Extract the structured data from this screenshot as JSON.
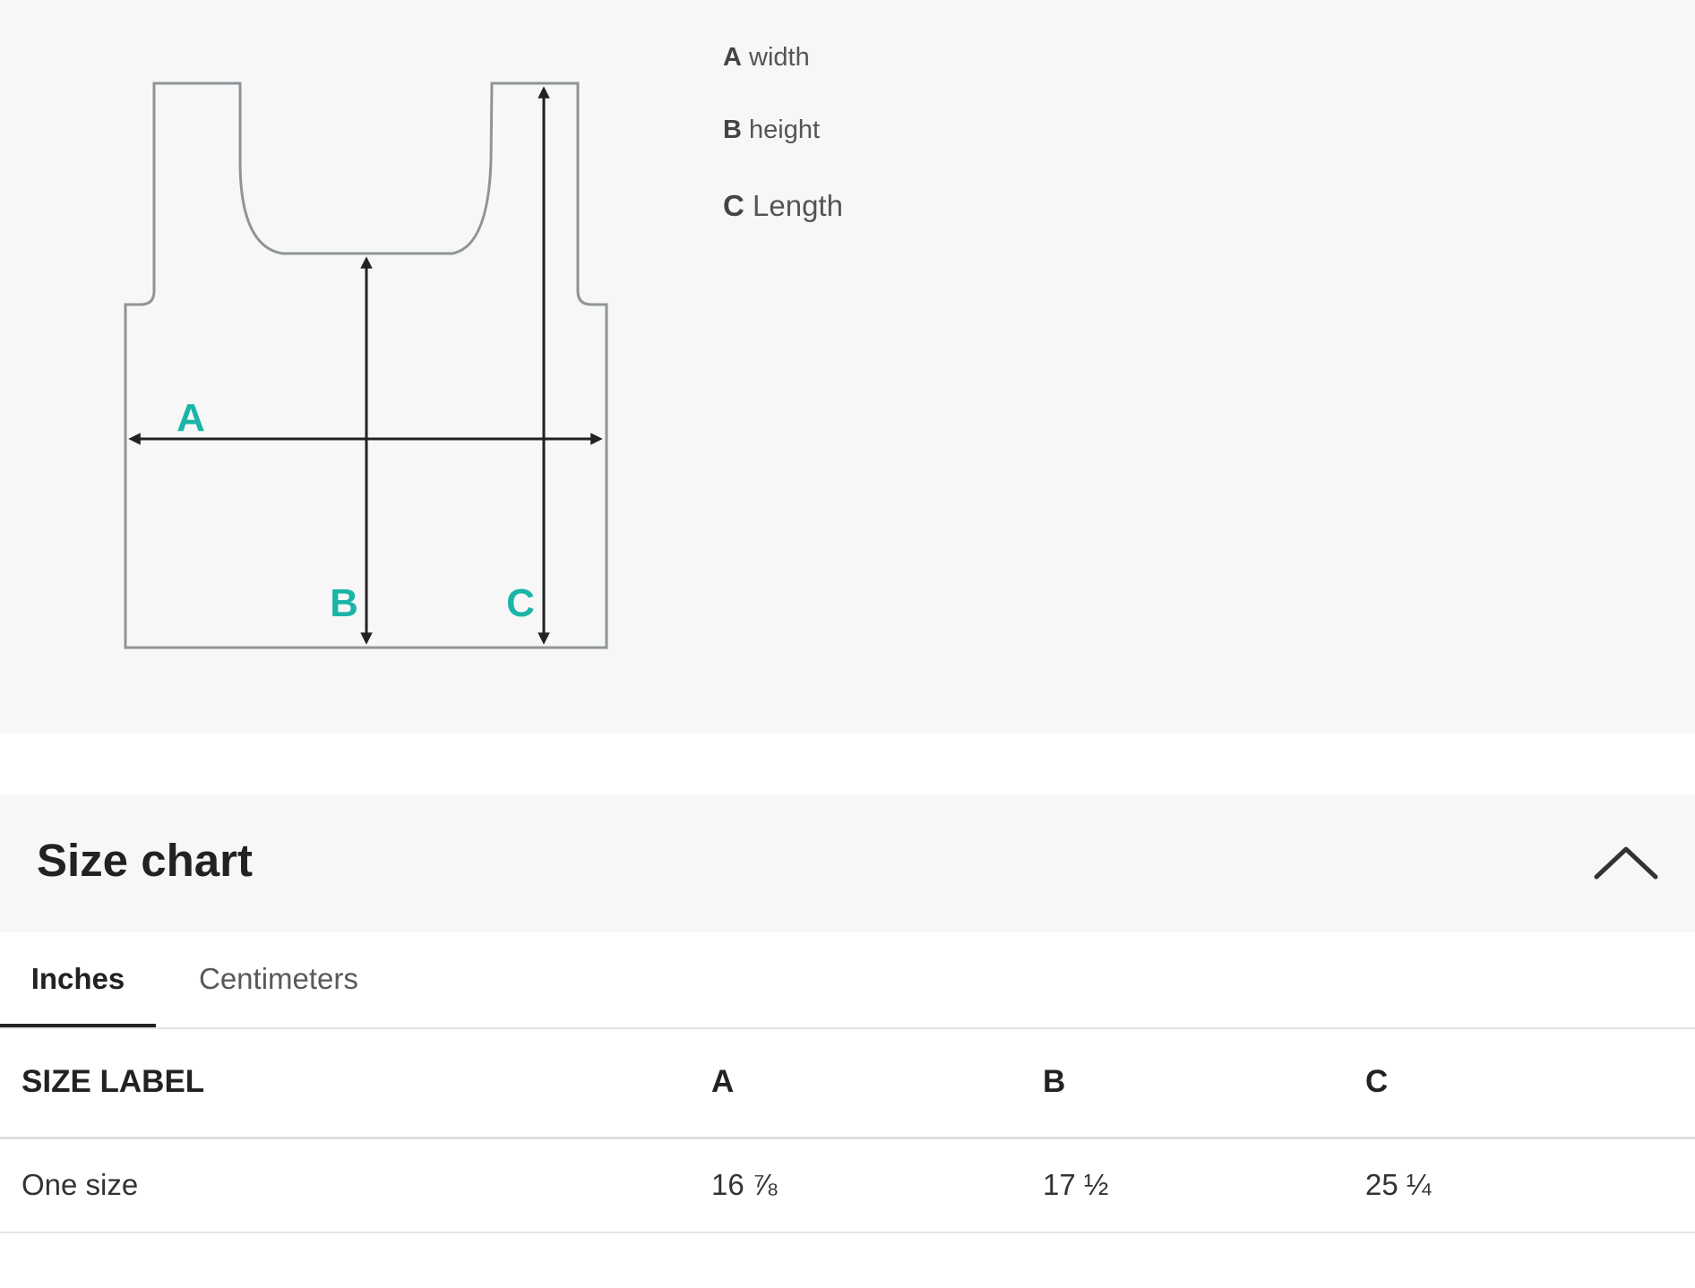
{
  "diagram": {
    "labels": {
      "a": "A",
      "b": "B",
      "c": "C"
    },
    "legend": [
      {
        "key": "A",
        "text": "width"
      },
      {
        "key": "B",
        "text": "height"
      },
      {
        "key": "C",
        "text": "Length"
      }
    ],
    "label_color": "#1ab5a6",
    "outline_color": "#8e9498",
    "arrow_color": "#222222"
  },
  "size_chart": {
    "title": "Size chart",
    "collapse_icon": "chevron-up-icon",
    "tabs": [
      {
        "label": "Inches",
        "active": true
      },
      {
        "label": "Centimeters",
        "active": false
      }
    ],
    "table": {
      "headers": [
        "SIZE LABEL",
        "A",
        "B",
        "C"
      ],
      "rows": [
        [
          "One size",
          "16 ⅞",
          "17 ½",
          "25 ¼"
        ]
      ]
    }
  }
}
